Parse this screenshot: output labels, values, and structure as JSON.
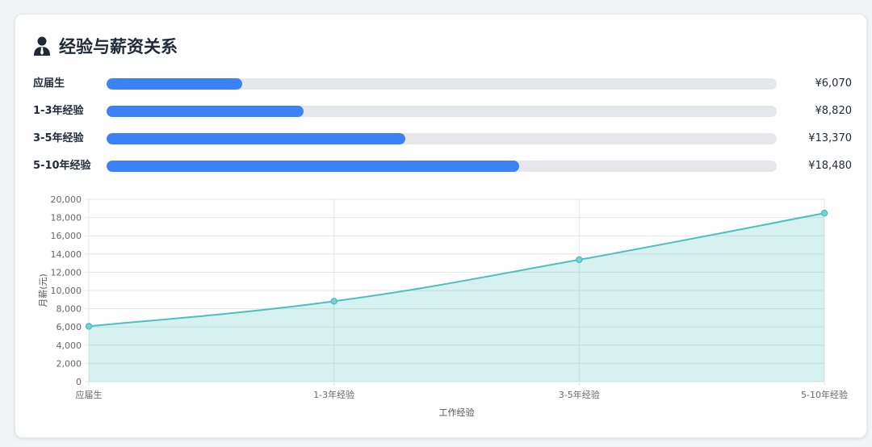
{
  "card": {
    "title": "经验与薪资关系",
    "icon": "user-tie-icon"
  },
  "bars": [
    {
      "label": "应届生",
      "value_text": "¥6,070",
      "value": 6070
    },
    {
      "label": "1-3年经验",
      "value_text": "¥8,820",
      "value": 8820
    },
    {
      "label": "3-5年经验",
      "value_text": "¥13,370",
      "value": 13370
    },
    {
      "label": "5-10年经验",
      "value_text": "¥18,480",
      "value": 18480
    }
  ],
  "bar_scale_max": 30000,
  "colors": {
    "bar_fill": "#3b82f6",
    "bar_track": "#e5e7eb",
    "line": "#4bc0c0",
    "area": "rgba(75,192,192,0.22)"
  },
  "chart_data": {
    "type": "area",
    "categories": [
      "应届生",
      "1-3年经验",
      "3-5年经验",
      "5-10年经验"
    ],
    "values": [
      6070,
      8820,
      13370,
      18480
    ],
    "xlabel": "工作经验",
    "ylabel": "月薪(元)",
    "ylim": [
      0,
      20000
    ],
    "yticks": [
      0,
      2000,
      4000,
      6000,
      8000,
      10000,
      12000,
      14000,
      16000,
      18000,
      20000
    ],
    "grid": true,
    "legend": "none"
  }
}
